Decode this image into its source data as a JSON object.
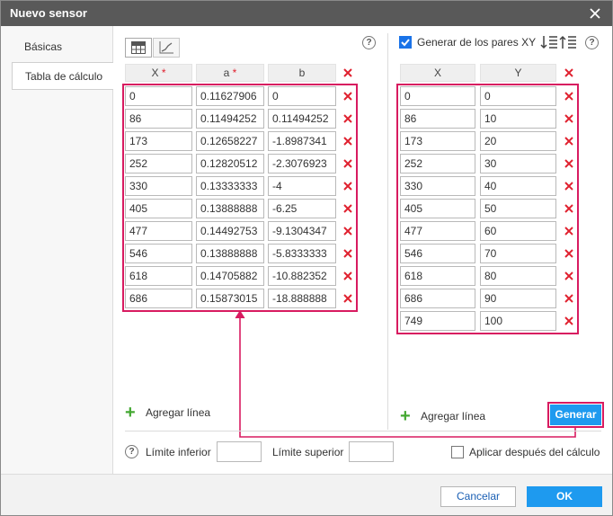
{
  "window": {
    "title": "Nuevo sensor"
  },
  "sidebar": {
    "tabs": [
      {
        "label": "Básicas"
      },
      {
        "label": "Tabla de cálculo"
      }
    ]
  },
  "left_table": {
    "headers": {
      "x": "X",
      "a": "a",
      "b": "b",
      "required_mark": "*"
    },
    "rows": [
      {
        "x": "0",
        "a": "0.11627906",
        "b": "0"
      },
      {
        "x": "86",
        "a": "0.11494252",
        "b": "0.11494252"
      },
      {
        "x": "173",
        "a": "0.12658227",
        "b": "-1.8987341"
      },
      {
        "x": "252",
        "a": "0.12820512",
        "b": "-2.3076923"
      },
      {
        "x": "330",
        "a": "0.13333333",
        "b": "-4"
      },
      {
        "x": "405",
        "a": "0.13888888",
        "b": "-6.25"
      },
      {
        "x": "477",
        "a": "0.14492753",
        "b": "-9.1304347"
      },
      {
        "x": "546",
        "a": "0.13888888",
        "b": "-5.8333333"
      },
      {
        "x": "618",
        "a": "0.14705882",
        "b": "-10.882352"
      },
      {
        "x": "686",
        "a": "0.15873015",
        "b": "-18.888888"
      }
    ],
    "add_line_label": "Agregar línea"
  },
  "right_table": {
    "generate_label": "Generar de los pares XY",
    "generate_checked": true,
    "headers": {
      "x": "X",
      "y": "Y"
    },
    "rows": [
      {
        "x": "0",
        "y": "0"
      },
      {
        "x": "86",
        "y": "10"
      },
      {
        "x": "173",
        "y": "20"
      },
      {
        "x": "252",
        "y": "30"
      },
      {
        "x": "330",
        "y": "40"
      },
      {
        "x": "405",
        "y": "50"
      },
      {
        "x": "477",
        "y": "60"
      },
      {
        "x": "546",
        "y": "70"
      },
      {
        "x": "618",
        "y": "80"
      },
      {
        "x": "686",
        "y": "90"
      },
      {
        "x": "749",
        "y": "100"
      }
    ],
    "add_line_label": "Agregar línea",
    "generate_button": "Generar"
  },
  "bottom": {
    "help_glyph": "?",
    "lower_limit_label": "Límite inferior",
    "lower_limit_value": "",
    "upper_limit_label": "Límite superior",
    "upper_limit_value": "",
    "apply_after_label": "Aplicar después del cálculo",
    "apply_after_checked": false
  },
  "footer": {
    "cancel": "Cancelar",
    "ok": "OK"
  },
  "icons": {
    "close": "close-icon",
    "table_view": "table-icon",
    "chart_view": "chart-icon",
    "sort_desc": "sort-descending-icon",
    "sort_asc": "sort-ascending-icon",
    "delete": "delete-x-icon",
    "add": "plus-icon",
    "help": "help-circle-icon"
  },
  "colors": {
    "accent": "#1e9aef",
    "delete": "#e0212f",
    "highlight": "#d81b60",
    "add": "#44a832",
    "titlebar": "#595959"
  }
}
